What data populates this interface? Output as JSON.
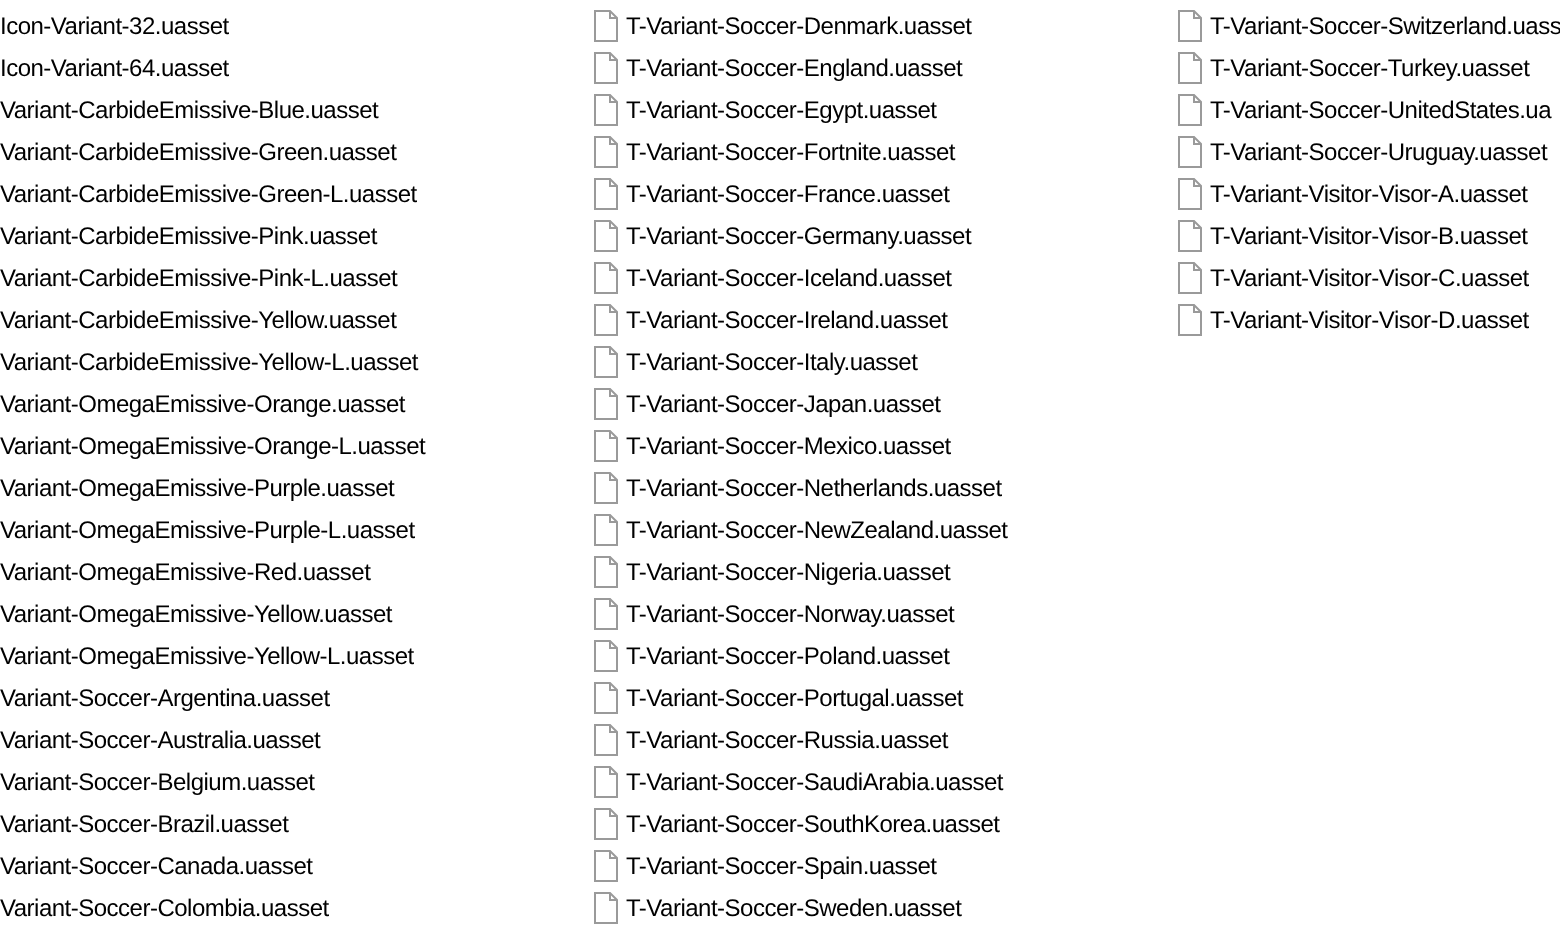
{
  "columns": [
    {
      "kind": "clipped",
      "items": [
        "Icon-Variant-32.uasset",
        "Icon-Variant-64.uasset",
        "Variant-CarbideEmissive-Blue.uasset",
        "Variant-CarbideEmissive-Green.uasset",
        "Variant-CarbideEmissive-Green-L.uasset",
        "Variant-CarbideEmissive-Pink.uasset",
        "Variant-CarbideEmissive-Pink-L.uasset",
        "Variant-CarbideEmissive-Yellow.uasset",
        "Variant-CarbideEmissive-Yellow-L.uasset",
        "Variant-OmegaEmissive-Orange.uasset",
        "Variant-OmegaEmissive-Orange-L.uasset",
        "Variant-OmegaEmissive-Purple.uasset",
        "Variant-OmegaEmissive-Purple-L.uasset",
        "Variant-OmegaEmissive-Red.uasset",
        "Variant-OmegaEmissive-Yellow.uasset",
        "Variant-OmegaEmissive-Yellow-L.uasset",
        "Variant-Soccer-Argentina.uasset",
        "Variant-Soccer-Australia.uasset",
        "Variant-Soccer-Belgium.uasset",
        "Variant-Soccer-Brazil.uasset",
        "Variant-Soccer-Canada.uasset",
        "Variant-Soccer-Colombia.uasset"
      ]
    },
    {
      "kind": "full",
      "items": [
        "T-Variant-Soccer-Denmark.uasset",
        "T-Variant-Soccer-England.uasset",
        "T-Variant-Soccer-Egypt.uasset",
        "T-Variant-Soccer-Fortnite.uasset",
        "T-Variant-Soccer-France.uasset",
        "T-Variant-Soccer-Germany.uasset",
        "T-Variant-Soccer-Iceland.uasset",
        "T-Variant-Soccer-Ireland.uasset",
        "T-Variant-Soccer-Italy.uasset",
        "T-Variant-Soccer-Japan.uasset",
        "T-Variant-Soccer-Mexico.uasset",
        "T-Variant-Soccer-Netherlands.uasset",
        "T-Variant-Soccer-NewZealand.uasset",
        "T-Variant-Soccer-Nigeria.uasset",
        "T-Variant-Soccer-Norway.uasset",
        "T-Variant-Soccer-Poland.uasset",
        "T-Variant-Soccer-Portugal.uasset",
        "T-Variant-Soccer-Russia.uasset",
        "T-Variant-Soccer-SaudiArabia.uasset",
        "T-Variant-Soccer-SouthKorea.uasset",
        "T-Variant-Soccer-Spain.uasset",
        "T-Variant-Soccer-Sweden.uasset"
      ]
    },
    {
      "kind": "full",
      "items": [
        "T-Variant-Soccer-Switzerland.uass",
        "T-Variant-Soccer-Turkey.uasset",
        "T-Variant-Soccer-UnitedStates.ua",
        "T-Variant-Soccer-Uruguay.uasset",
        "T-Variant-Visitor-Visor-A.uasset",
        "T-Variant-Visitor-Visor-B.uasset",
        "T-Variant-Visitor-Visor-C.uasset",
        "T-Variant-Visitor-Visor-D.uasset"
      ]
    }
  ]
}
